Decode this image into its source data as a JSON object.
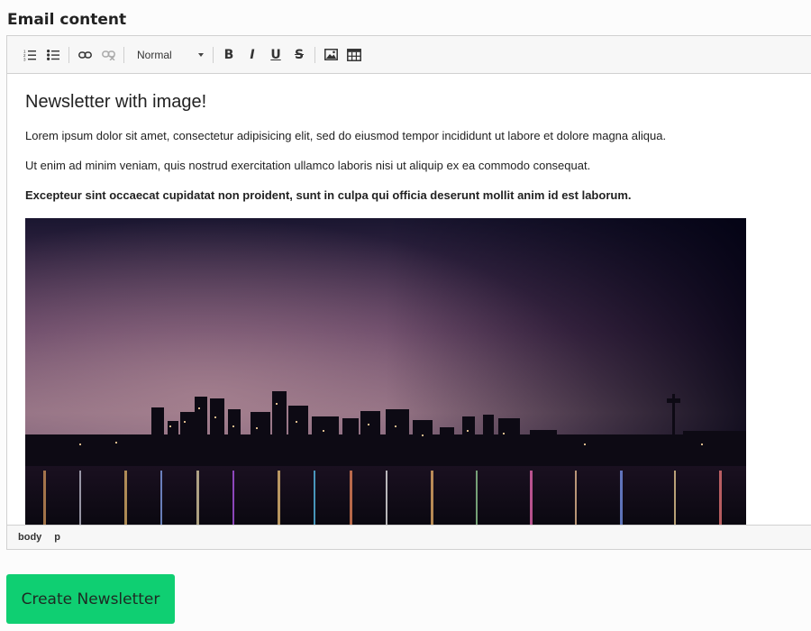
{
  "section_label": "Email content",
  "toolbar": {
    "format_value": "Normal",
    "bold_glyph": "B",
    "italic_glyph": "I",
    "underline_glyph": "U",
    "strike_glyph": "S",
    "icons": [
      "ordered-list-icon",
      "bullet-list-icon",
      "link-icon",
      "unlink-icon",
      "image-icon",
      "table-icon"
    ]
  },
  "content": {
    "heading": "Newsletter with image!",
    "paragraph_1": "Lorem ipsum dolor sit amet, consectetur adipisicing elit, sed do eiusmod tempor incididunt ut labore et dolore magna aliqua.",
    "paragraph_2": "Ut enim ad minim veniam, quis nostrud exercitation ullamco laboris nisi ut aliquip ex ea commodo consequat.",
    "paragraph_3": "Excepteur sint occaecat cupidatat non proident, sunt in culpa qui officia deserunt mollit anim id est laborum."
  },
  "status_bar": {
    "path": [
      "body",
      "p"
    ]
  },
  "actions": {
    "create_label": "Create Newsletter"
  },
  "colors": {
    "accent_button": "#0fcf72"
  }
}
